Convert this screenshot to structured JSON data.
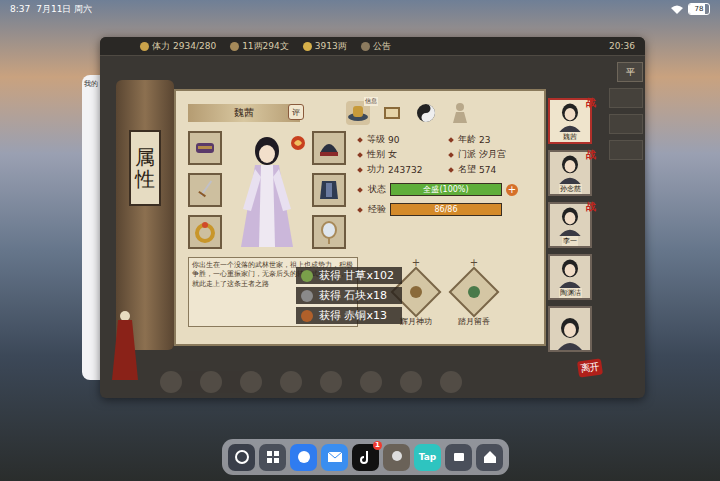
{
  "status_bar": {
    "time": "8:37",
    "date": "7月11日 周六",
    "battery": "78",
    "battery_level": 0.78
  },
  "side_app": {
    "label": "我的"
  },
  "game": {
    "top_bar": [
      {
        "kind": "stamina",
        "label": "体力",
        "value": "2934/280"
      },
      {
        "kind": "coin",
        "value": "11两294文"
      },
      {
        "kind": "ingot",
        "value": "3913两"
      },
      {
        "kind": "notice",
        "value": "公告"
      }
    ],
    "clock": "20:36",
    "side_button": "平",
    "panel_title": "属性",
    "character": {
      "name": "魏茜",
      "rating": "评"
    },
    "icon_tabs": [
      {
        "kind": "hat",
        "label": "信息",
        "selected": true
      },
      {
        "kind": "book",
        "selected": false
      },
      {
        "kind": "yinyang",
        "selected": false
      },
      {
        "kind": "body",
        "selected": false
      }
    ],
    "equipment": [
      {
        "kind": "bracer"
      },
      {
        "kind": "helmet"
      },
      {
        "kind": "sword"
      },
      {
        "kind": "armor"
      },
      {
        "kind": "ring"
      },
      {
        "kind": "mirror"
      }
    ],
    "stats": [
      {
        "label": "等级",
        "value": "90"
      },
      {
        "label": "年龄",
        "value": "23"
      },
      {
        "label": "性别",
        "value": "女"
      },
      {
        "label": "门派",
        "value": "汐月宫"
      },
      {
        "label": "功力",
        "value": "243732"
      },
      {
        "label": "名望",
        "value": "574"
      }
    ],
    "bars": [
      {
        "label": "状态",
        "text": "全盛(100%)",
        "level": 1,
        "color": "#5fae3a",
        "plus": "+"
      },
      {
        "label": "经验",
        "text": "86/86",
        "level": 1,
        "color": "#d48a2a"
      }
    ],
    "description": "你出生在一个没落的武林世家，祖上也成势力，积极争胜，一心重振家门，无奈后头的转世武家毁门，并就此走上了这条王者之路",
    "skills": [
      {
        "name": "辉月神功",
        "plus": "+"
      },
      {
        "name": "踏月留香",
        "plus": "+"
      }
    ],
    "notifications": [
      {
        "kind": "herb",
        "text": "获得 甘草x102"
      },
      {
        "kind": "stone",
        "text": "获得 石块x18"
      },
      {
        "kind": "copper",
        "text": "获得 赤铜x13"
      }
    ],
    "team": [
      {
        "name": "魏茜",
        "selected": true,
        "mark": "战"
      },
      {
        "name": "孙念慈",
        "selected": false,
        "mark": "战"
      },
      {
        "name": "李一",
        "selected": false,
        "mark": "战"
      },
      {
        "name": "陶渊洁",
        "selected": false
      },
      {
        "selected": false
      }
    ],
    "leave": "离开"
  },
  "dock": [
    {
      "kind": "swirl"
    },
    {
      "kind": "grid"
    },
    {
      "kind": "browser"
    },
    {
      "kind": "mail"
    },
    {
      "kind": "tiktok",
      "badge": "1"
    },
    {
      "kind": "game"
    },
    {
      "kind": "tap",
      "label": "Tap"
    },
    {
      "kind": "files"
    },
    {
      "kind": "home"
    }
  ]
}
